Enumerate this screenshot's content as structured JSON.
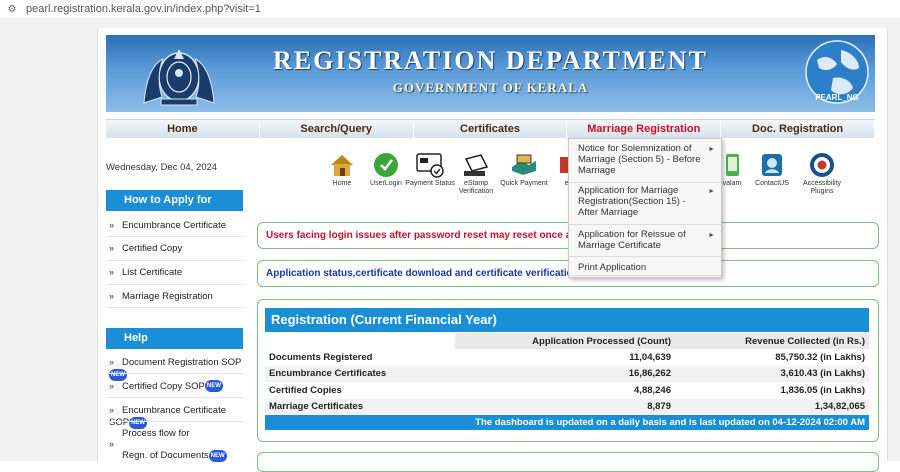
{
  "browser": {
    "url": "pearl.registration.kerala.gov.in/index.php?visit=1"
  },
  "banner": {
    "title": "REGISTRATION DEPARTMENT",
    "subtitle": "GOVERNMENT OF KERALA",
    "globe_text": "PEARL_NG"
  },
  "nav": [
    "Home",
    "Search/Query",
    "Certificates",
    "Marriage Registration",
    "Doc. Registration"
  ],
  "nav_active": "Marriage Registration",
  "date": "Wednesday, Dec 04, 2024",
  "icons": [
    {
      "label": "Home",
      "icon": "home-icon"
    },
    {
      "label": "UserLogin",
      "icon": "user-login-icon"
    },
    {
      "label": "Payment Status",
      "icon": "payment-status-icon"
    },
    {
      "label": "eStamp Verification",
      "icon": "estamp-icon"
    },
    {
      "label": "Quick Payment",
      "icon": "quick-payment-icon"
    },
    {
      "label": "e-P",
      "icon": "epayment-icon"
    },
    {
      "label": "valam",
      "icon": "mobile-icon"
    },
    {
      "label": "ContactUS",
      "icon": "contact-icon"
    },
    {
      "label": "Accessibility Plugins",
      "icon": "accessibility-icon"
    }
  ],
  "sidebar": {
    "how_to_apply": {
      "heading": "How to Apply for",
      "items": [
        "Encumbrance Certificate",
        "Certified Copy",
        "List Certificate",
        "Marriage Registration"
      ]
    },
    "help": {
      "heading": "Help",
      "items": [
        "Document Registration SOP",
        "Certified Copy SOP",
        "Encumbrance Certificate SOP",
        "Process flow for",
        "Regn. of Documents"
      ],
      "new_label": "NEW"
    }
  },
  "notices": {
    "login": "Users facing login issues after password reset may reset once a",
    "status": "Application status,certificate download and certificate verification",
    "status_tail": "..."
  },
  "dropdown": [
    "Notice for Solemnization of Marriage (Section 5) - Before Marriage",
    "Application for Marriage Registration(Section 15) - After Marriage",
    "Application for Reissue of Marriage Certificate",
    "Print Application"
  ],
  "stats": {
    "heading": "Registration (Current Financial Year)",
    "col_count": "Application Processed (Count)",
    "col_revenue": "Revenue Collected (in Rs.)",
    "rows": [
      {
        "label": "Documents Registered",
        "count": "11,04,639",
        "revenue": "85,750.32 (in Lakhs)"
      },
      {
        "label": "Encumbrance Certificates",
        "count": "16,86,262",
        "revenue": "3,610.43 (in Lakhs)"
      },
      {
        "label": "Certified Copies",
        "count": "4,88,246",
        "revenue": "1,836.05 (in Lakhs)"
      },
      {
        "label": "Marriage Certificates",
        "count": "8,879",
        "revenue": "1,34,82,065"
      }
    ],
    "updated": "The dashboard is updated on a daily basis and is last updated on 04-12-2024 02:00 AM"
  },
  "colors": {
    "primary_blue": "#1a8fd6",
    "accent_red": "#c8102e",
    "notice_border": "#7cc07c"
  }
}
